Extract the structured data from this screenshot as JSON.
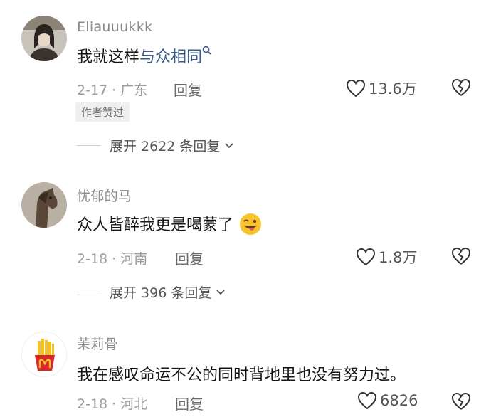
{
  "comments": [
    {
      "username": "Eliauuukkk",
      "text_plain": "我就这样",
      "text_link": "与众相同",
      "date_location": "2-17 · 广东",
      "reply_label": "回复",
      "likes": "13.6万",
      "badge": "作者赞过",
      "expand_label": "展开 2622 条回复",
      "avatar_icon": "portrait-avatar-icon"
    },
    {
      "username": "忧郁的马",
      "text": "众人皆醉我更是喝蒙了",
      "emoji": "wink-tongue-emoji-icon",
      "date_location": "2-18 · 河南",
      "reply_label": "回复",
      "likes": "1.8万",
      "expand_label": "展开 396 条回复",
      "avatar_icon": "horse-avatar-icon"
    },
    {
      "username": "茉莉骨",
      "text": "我在感叹命运不公的同时背地里也没有努力过。",
      "date_location": "2-18 · 河北",
      "reply_label": "回复",
      "likes": "6826",
      "avatar_icon": "fries-avatar-icon"
    }
  ],
  "colors": {
    "link": "#3b5b8a",
    "meta": "#9b9b9b"
  }
}
